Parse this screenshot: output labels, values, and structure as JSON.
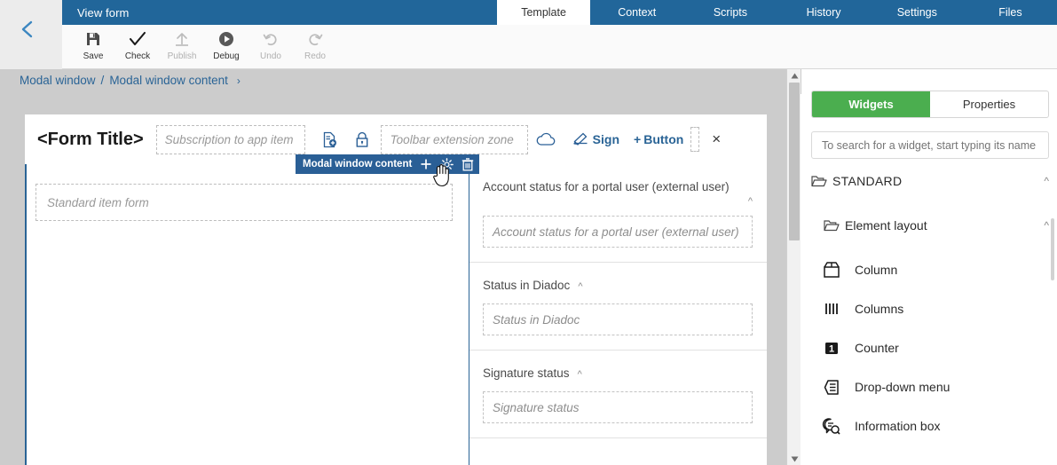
{
  "header": {
    "title": "View form",
    "back_icon": "chevron-left-icon",
    "tabs": [
      {
        "label": "Template",
        "active": true
      },
      {
        "label": "Context",
        "active": false
      },
      {
        "label": "Scripts",
        "active": false
      },
      {
        "label": "History",
        "active": false
      },
      {
        "label": "Settings",
        "active": false
      },
      {
        "label": "Files",
        "active": false
      }
    ],
    "accent_blue": "#21669a"
  },
  "toolbar": {
    "items": [
      {
        "label": "Save",
        "icon": "save-icon",
        "enabled": true
      },
      {
        "label": "Check",
        "icon": "check-icon",
        "enabled": true
      },
      {
        "label": "Publish",
        "icon": "upload-icon",
        "enabled": false
      },
      {
        "label": "Debug",
        "icon": "play-icon",
        "enabled": true
      },
      {
        "label": "Undo",
        "icon": "undo-icon",
        "enabled": false
      },
      {
        "label": "Redo",
        "icon": "redo-icon",
        "enabled": false
      }
    ]
  },
  "breadcrumb": {
    "items": [
      "Modal window",
      "Modal window content"
    ],
    "separator": "/",
    "trailing": "›"
  },
  "form": {
    "title": "<Form Title>",
    "subscription_zone": "Subscription to app item",
    "toolbar_extension_zone": "Toolbar extension zone",
    "icons": [
      {
        "name": "document-settings-icon"
      },
      {
        "name": "lock-icon"
      },
      {
        "name": "cloud-icon"
      }
    ],
    "sign_label": "Sign",
    "button_label": "Button",
    "button_plus": "+",
    "close_label": "×",
    "item_form_placeholder": "Standard item form"
  },
  "selection_chip": {
    "label": "Modal window content",
    "actions": [
      {
        "name": "add-icon",
        "glyph": "+"
      },
      {
        "name": "settings-gear-icon"
      },
      {
        "name": "delete-trash-icon"
      }
    ]
  },
  "fields": [
    {
      "label": "Account status for a portal user (external user)",
      "placeholder": "Account status for a portal user (external user)",
      "collapse_icon": "chevron-up-icon"
    },
    {
      "label": "Status in Diadoc",
      "placeholder": "Status in Diadoc",
      "collapse_icon": "chevron-up-icon"
    },
    {
      "label": "Signature status",
      "placeholder": "Signature status",
      "collapse_icon": "chevron-up-icon"
    }
  ],
  "sidebar": {
    "tabs": [
      {
        "label": "Widgets",
        "active": true
      },
      {
        "label": "Properties",
        "active": false
      }
    ],
    "search_placeholder": "To search for a widget, start typing its name",
    "search_value": "",
    "groups": [
      {
        "label": "STANDARD",
        "icon": "folder-open-icon",
        "caret": "chevron-up-icon"
      },
      {
        "label": "Element layout",
        "icon": "folder-open-icon",
        "caret": "chevron-up-icon"
      }
    ],
    "widgets": [
      {
        "label": "Column",
        "icon": "column-box-icon"
      },
      {
        "label": "Columns",
        "icon": "columns-bars-icon"
      },
      {
        "label": "Counter",
        "icon": "counter-one-icon"
      },
      {
        "label": "Drop-down menu",
        "icon": "dropdown-menu-icon"
      },
      {
        "label": "Information box",
        "icon": "information-box-icon"
      }
    ],
    "accent_green": "#4bae4f"
  }
}
